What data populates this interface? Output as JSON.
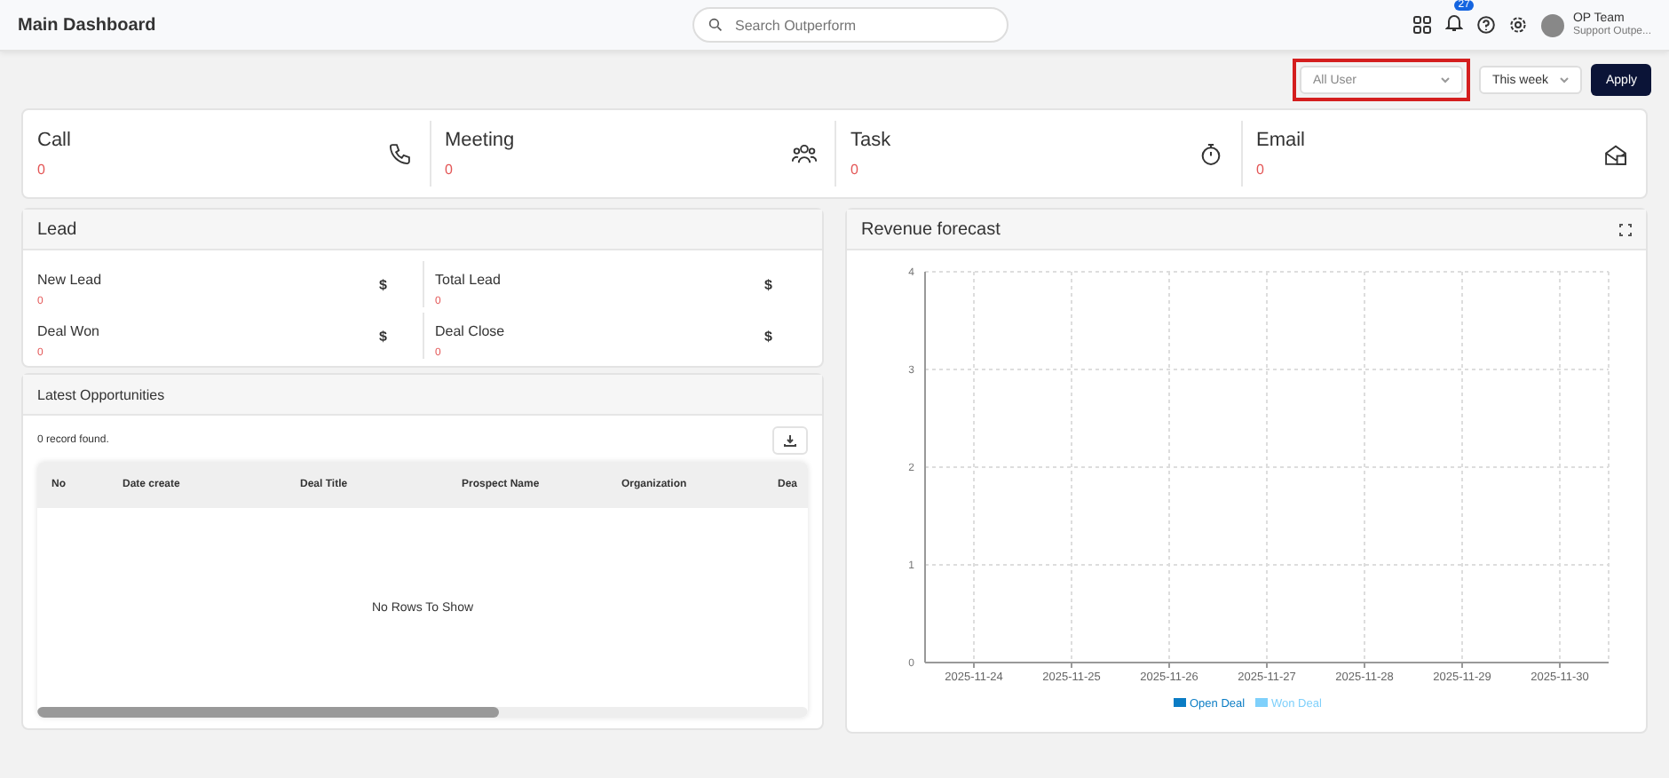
{
  "header": {
    "title": "Main Dashboard",
    "search": {
      "placeholder": "Search Outperform"
    },
    "notification_count": "27",
    "user": {
      "name": "OP Team",
      "role": "Support Outpe..."
    }
  },
  "filters": {
    "user_select": {
      "value": "All User",
      "highlighted": true
    },
    "period_select": {
      "value": "This week"
    },
    "apply": "Apply"
  },
  "stats": [
    {
      "kind": "phone",
      "label": "Call",
      "value": "0"
    },
    {
      "kind": "people",
      "label": "Meeting",
      "value": "0"
    },
    {
      "kind": "timer",
      "label": "Task",
      "value": "0"
    },
    {
      "kind": "mail",
      "label": "Email",
      "value": "0"
    }
  ],
  "lead": {
    "title": "Lead",
    "items": [
      {
        "label": "New Lead",
        "value": "0",
        "currency": "$"
      },
      {
        "label": "Total Lead",
        "value": "0",
        "currency": "$"
      },
      {
        "label": "Deal Won",
        "value": "0",
        "currency": "$"
      },
      {
        "label": "Deal Close",
        "value": "0",
        "currency": "$"
      }
    ]
  },
  "opportunities": {
    "title": "Latest Opportunities",
    "count": "0 record found.",
    "columns": [
      "No",
      "Date create",
      "Deal Title",
      "Prospect Name",
      "Organization",
      "Dea"
    ],
    "empty_message": "No Rows To Show"
  },
  "revenue": {
    "title": "Revenue forecast",
    "chart_data": {
      "type": "bar",
      "categories": [
        "2025-11-24",
        "2025-11-25",
        "2025-11-26",
        "2025-11-27",
        "2025-11-28",
        "2025-11-29",
        "2025-11-30"
      ],
      "series": [
        {
          "name": "Open Deal",
          "color": "#0a7cc4",
          "values": [
            0,
            0,
            0,
            0,
            0,
            0,
            0
          ]
        },
        {
          "name": "Won Deal",
          "color": "#7fd0fb",
          "values": [
            0,
            0,
            0,
            0,
            0,
            0,
            0
          ]
        }
      ],
      "ylim": [
        0,
        4
      ],
      "yticks": [
        0,
        1,
        2,
        3,
        4
      ],
      "grid": true
    }
  }
}
